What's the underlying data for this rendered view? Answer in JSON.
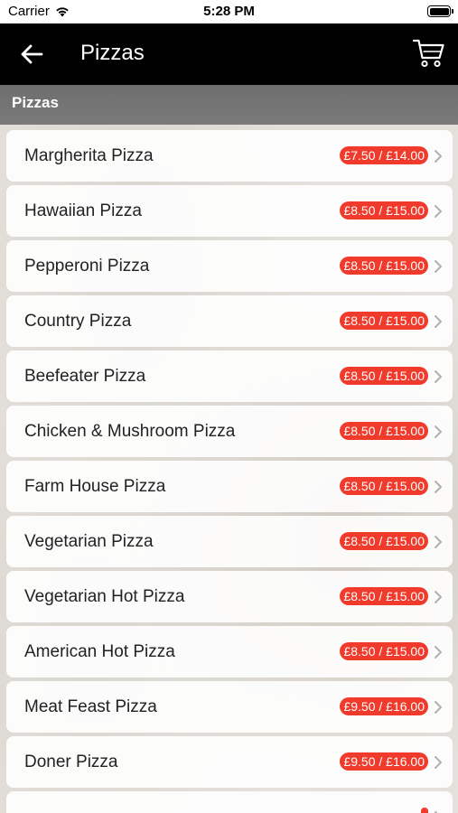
{
  "status_bar": {
    "carrier": "Carrier",
    "time": "5:28 PM"
  },
  "nav": {
    "title": "Pizzas"
  },
  "section": {
    "title": "Pizzas"
  },
  "items": [
    {
      "name": "Margherita Pizza",
      "price": "£7.50 / £14.00"
    },
    {
      "name": "Hawaiian Pizza",
      "price": "£8.50 / £15.00"
    },
    {
      "name": "Pepperoni Pizza",
      "price": "£8.50 / £15.00"
    },
    {
      "name": "Country Pizza",
      "price": "£8.50 / £15.00"
    },
    {
      "name": "Beefeater Pizza",
      "price": "£8.50 / £15.00"
    },
    {
      "name": "Chicken & Mushroom Pizza",
      "price": "£8.50 / £15.00"
    },
    {
      "name": "Farm House Pizza",
      "price": "£8.50 / £15.00"
    },
    {
      "name": "Vegetarian Pizza",
      "price": "£8.50 / £15.00"
    },
    {
      "name": "Vegetarian Hot Pizza",
      "price": "£8.50 / £15.00"
    },
    {
      "name": "American Hot Pizza",
      "price": "£8.50 / £15.00"
    },
    {
      "name": "Meat Feast Pizza",
      "price": "£9.50 / £16.00"
    },
    {
      "name": "Doner Pizza",
      "price": "£9.50 / £16.00"
    },
    {
      "name": "",
      "price": ""
    }
  ],
  "colors": {
    "price_badge": "#f03a2c",
    "nav_background": "#000000",
    "section_header": "#737373"
  },
  "icons": {
    "back": "arrow-left-icon",
    "cart": "shopping-cart-icon",
    "chevron": "chevron-right-icon",
    "wifi": "wifi-icon",
    "battery": "battery-icon"
  }
}
